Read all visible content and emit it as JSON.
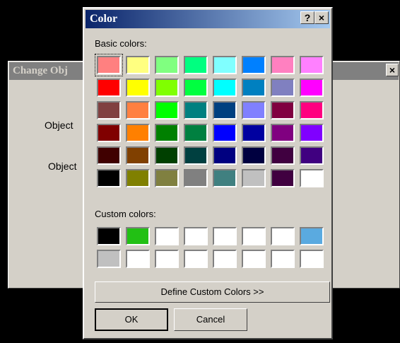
{
  "background_dialog": {
    "title": "Change Obj",
    "close_glyph": "×",
    "labels": [
      "Object",
      "Object"
    ]
  },
  "dialog": {
    "title": "Color",
    "help_glyph": "?",
    "close_glyph": "×",
    "basic_label": "Basic colors:",
    "custom_label": "Custom colors:",
    "define_button": "Define Custom Colors >>",
    "ok_button": "OK",
    "cancel_button": "Cancel"
  },
  "basic_colors": [
    [
      "#ff8080",
      "#ffff80",
      "#80ff80",
      "#00ff80",
      "#80ffff",
      "#0080ff",
      "#ff80c0",
      "#ff80ff"
    ],
    [
      "#ff0000",
      "#ffff00",
      "#80ff00",
      "#00ff40",
      "#00ffff",
      "#0080c0",
      "#8080c0",
      "#ff00ff"
    ],
    [
      "#804040",
      "#ff8040",
      "#00ff00",
      "#008080",
      "#004080",
      "#8080ff",
      "#800040",
      "#ff0080"
    ],
    [
      "#800000",
      "#ff8000",
      "#008000",
      "#008040",
      "#0000ff",
      "#0000a0",
      "#800080",
      "#8000ff"
    ],
    [
      "#400000",
      "#804000",
      "#004000",
      "#004040",
      "#000080",
      "#000040",
      "#400040",
      "#400080"
    ],
    [
      "#000000",
      "#808000",
      "#808040",
      "#808080",
      "#408080",
      "#c0c0c0",
      "#400040",
      "#ffffff"
    ]
  ],
  "custom_colors": [
    [
      "#000000",
      "#22c014",
      "#ffffff",
      "#ffffff",
      "#ffffff",
      "#ffffff",
      "#ffffff",
      "#5aaae0"
    ],
    [
      "#c0c0c0",
      "#ffffff",
      "#ffffff",
      "#ffffff",
      "#ffffff",
      "#ffffff",
      "#ffffff",
      "#ffffff"
    ]
  ],
  "selected_basic": [
    0,
    0
  ]
}
